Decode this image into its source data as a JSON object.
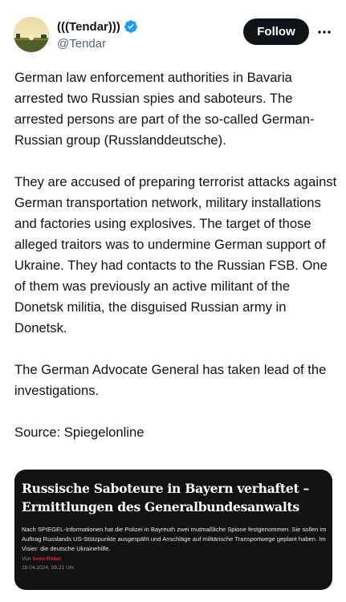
{
  "author": {
    "display_name": "(((Tendar)))",
    "handle": "@Tendar",
    "verified": true,
    "avatar_icon": "sunset-landscape-avatar"
  },
  "actions": {
    "follow_label": "Follow",
    "more_icon": "more-horizontal-icon"
  },
  "tweet": {
    "paragraphs": [
      "German law enforcement authorities in Bavaria arrested two Russian spies and saboteurs. The arrested persons are part of the so-called German-Russian group (Russlanddeutsche).",
      "They are accused of preparing terrorist attacks against German transportation network, military installations and factories using explosives. The target of those alleged traitors was to undermine German support of Ukraine. They had contacts to the Russian FSB. One of them was previously an active militant of the Donetsk militia, the disguised Russian army in Donetsk.",
      "The German Advocate General has taken lead of the investigations.",
      "Source: Spiegelonline"
    ]
  },
  "card": {
    "headline": "Russische Saboteure in Bayern verhaftet – Ermittlungen des Generalbundesanwalts",
    "lead": "Nach SPIEGEL-Informationen hat die Polizei in Bayreuth zwei mutmaßliche Spione festgenommen. Sie sollen im Auftrag Russlands US-Stützpunkte ausgespäht und Anschläge auf militärische Transportwege geplant haben. Im Visier: die deutsche Ukrainehilfe.",
    "author_prefix": "Von",
    "author_name": "Sven Röbel",
    "date": "18.04.2024, 08.21 Uhr"
  },
  "colors": {
    "verified_badge": "#1d9bf0",
    "follow_button_bg": "#0f1419",
    "card_bg": "#121212",
    "author_link": "#d32f2f"
  }
}
